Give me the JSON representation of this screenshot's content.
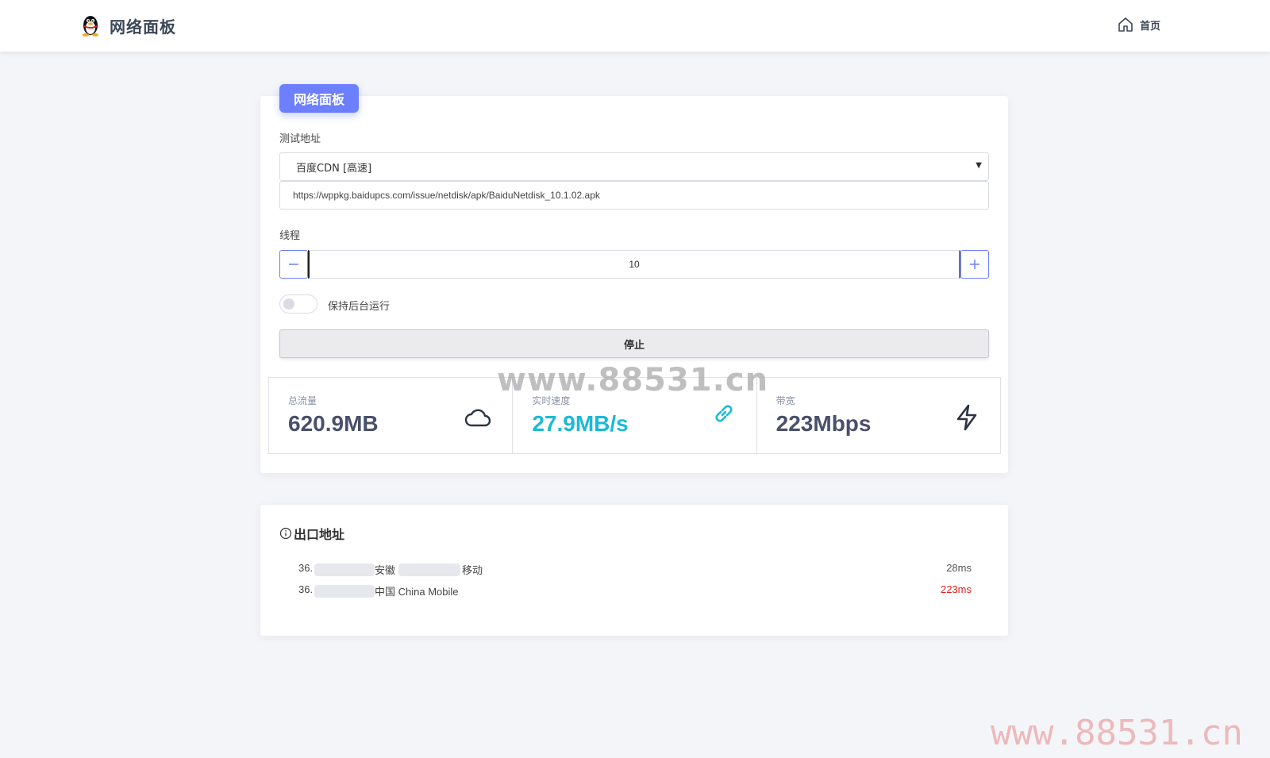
{
  "header": {
    "title": "网络面板",
    "nav_home_label": "首页"
  },
  "panel": {
    "tab_label": "网络面板",
    "test_address_label": "测试地址",
    "selected_source": "百度CDN [高速]",
    "url_value": "https://wppkg.baidupcs.com/issue/netdisk/apk/BaiduNetdisk_10.1.02.apk",
    "threads_label": "线程",
    "threads_value": "10",
    "keep_background_label": "保持后台运行",
    "keep_background_on": false,
    "stop_button_label": "停止"
  },
  "stats": [
    {
      "label": "总流量",
      "value": "620.9MB",
      "icon": "cloud-icon",
      "color": "#48506a"
    },
    {
      "label": "实时速度",
      "value": "27.9MB/s",
      "icon": "link-icon",
      "color": "#1ab9d8"
    },
    {
      "label": "带宽",
      "value": "223Mbps",
      "icon": "lightning-icon",
      "color": "#48506a"
    }
  ],
  "exit": {
    "title": "出口地址",
    "rows": [
      {
        "ip_prefix": "36.",
        "location": "安徽",
        "isp": "移动",
        "latency": "28ms",
        "latency_color": "#555555"
      },
      {
        "ip_prefix": "36.",
        "location": "中国 China Mobile",
        "isp": "",
        "latency": "223ms",
        "latency_color": "#e02020"
      }
    ]
  },
  "watermarks": {
    "center": "www.88531.cn",
    "corner": "www.88531.cn"
  },
  "colors": {
    "accent": "#6c7fff",
    "speed": "#1ab9d8",
    "high_latency": "#e02020"
  }
}
